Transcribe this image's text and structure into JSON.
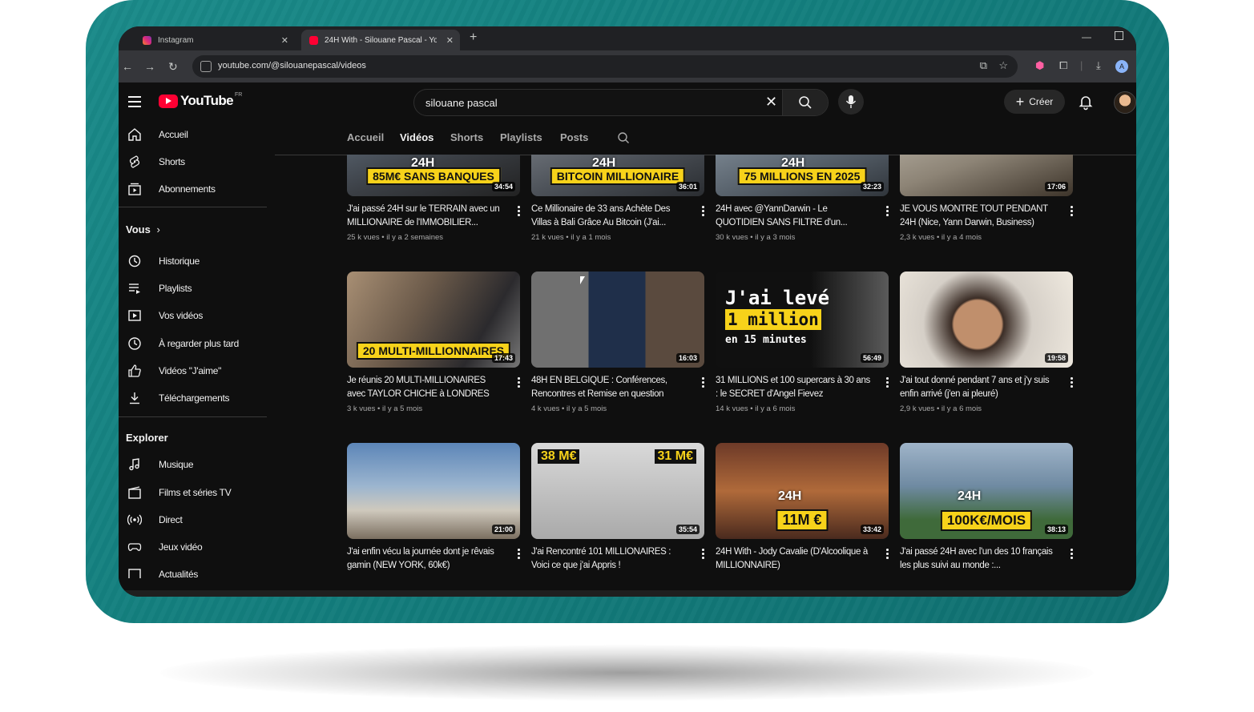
{
  "browser": {
    "tabs": [
      {
        "title": "Instagram",
        "active": false
      },
      {
        "title": "24H With - Silouane Pascal - Yo",
        "active": true
      }
    ],
    "url": "youtube.com/@silouanepascal/videos",
    "profile_initial": "A"
  },
  "header": {
    "logo_text": "YouTube",
    "region": "FR",
    "search_value": "silouane pascal",
    "create_label": "Créer"
  },
  "sidebar": {
    "main": [
      "Accueil",
      "Shorts",
      "Abonnements"
    ],
    "you_heading": "Vous",
    "you_items": [
      "Historique",
      "Playlists",
      "Vos vidéos",
      "À regarder plus tard",
      "Vidéos \"J'aime\"",
      "Téléchargements"
    ],
    "explore_heading": "Explorer",
    "explore_items": [
      "Musique",
      "Films et séries TV",
      "Direct",
      "Jeux vidéo",
      "Actualités"
    ]
  },
  "channel_tabs": [
    "Accueil",
    "Vidéos",
    "Shorts",
    "Playlists",
    "Posts"
  ],
  "active_tab": "Vidéos",
  "videos": [
    {
      "title": "J'ai passé 24H sur le TERRAIN avec un MILLIONAIRE de l'IMMOBILIER...",
      "meta": "25 k vues • il y a 2 semaines",
      "duration": "34:54",
      "overlay": "85M€ SANS BANQUES",
      "tag": "24H"
    },
    {
      "title": "Ce Millionaire de 33 ans Achète Des Villas à Bali Grâce Au Bitcoin (J'ai...",
      "meta": "21 k vues • il y a 1 mois",
      "duration": "36:01",
      "overlay": "BITCOIN MILLIONAIRE",
      "tag": "24H"
    },
    {
      "title": "24H avec @YannDarwin - Le QUOTIDIEN SANS FILTRE d'un...",
      "meta": "30 k vues • il y a 3 mois",
      "duration": "32:23",
      "overlay": "75 MILLIONS EN 2025",
      "tag": "24H"
    },
    {
      "title": "JE VOUS MONTRE TOUT PENDANT 24H (Nice, Yann Darwin, Business)",
      "meta": "2,3 k vues • il y a 4 mois",
      "duration": "17:06",
      "overlay": "",
      "tag": ""
    },
    {
      "title": "Je réunis 20 MULTI-MILLIONAIRES avec TAYLOR CHICHE à LONDRES",
      "meta": "3 k vues • il y a 5 mois",
      "duration": "17:43",
      "overlay": "20 MULTI-MILLIONNAIRES",
      "tag": ""
    },
    {
      "title": "48H EN BELGIQUE : Conférences, Rencontres et Remise en question",
      "meta": "4 k vues • il y a 5 mois",
      "duration": "16:03",
      "overlay": "",
      "tag": ""
    },
    {
      "title": "31 MILLIONS et 100 supercars à 30 ans : le SECRET d'Angel Fievez",
      "meta": "14 k vues • il y a 6 mois",
      "duration": "56:49",
      "overlay": "",
      "tag": "",
      "big_text": [
        "J'ai levé",
        "1 million",
        "en 15 minutes"
      ]
    },
    {
      "title": "J'ai tout donné pendant 7 ans et j'y suis enfin arrivé (j'en ai pleuré)",
      "meta": "2,9 k vues • il y a 6 mois",
      "duration": "19:58",
      "overlay": "",
      "tag": ""
    },
    {
      "title": "J'ai enfin vécu la journée dont je rêvais gamin (NEW YORK, 60k€)",
      "meta": "",
      "duration": "21:00",
      "overlay": "",
      "tag": ""
    },
    {
      "title": "J'ai Rencontré 101 MILLIONAIRES : Voici ce que j'ai Appris !",
      "meta": "",
      "duration": "35:54",
      "overlay": "",
      "tag": "",
      "badges": [
        "38 M€",
        "31 M€"
      ]
    },
    {
      "title": "24H With - Jody Cavalie (D'Alcoolique à MILLIONNAIRE)",
      "meta": "",
      "duration": "33:42",
      "overlay": "11M €",
      "tag": "24H"
    },
    {
      "title": "J'ai passé 24H avec l'un des 10 français les plus suivi au monde :...",
      "meta": "",
      "duration": "38:13",
      "overlay": "100K€/MOIS",
      "tag": "24H"
    }
  ],
  "colors": {
    "yt_red": "#ff0033",
    "accent_yellow": "#f7d21a",
    "frame_teal": "#137f7e",
    "bg": "#0f0f0f"
  }
}
